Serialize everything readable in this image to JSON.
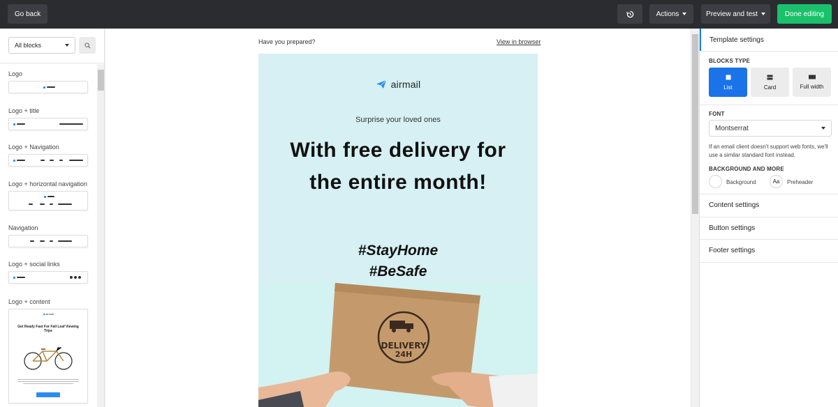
{
  "topbar": {
    "go_back": "Go back",
    "actions": "Actions",
    "preview": "Preview and test",
    "done": "Done editing"
  },
  "left_panel": {
    "filter_value": "All blocks",
    "blocks": [
      {
        "label": "Logo"
      },
      {
        "label": "Logo + title"
      },
      {
        "label": "Logo + Navigation"
      },
      {
        "label": "Logo + horizontal navigation"
      },
      {
        "label": "Navigation"
      },
      {
        "label": "Logo + social links"
      },
      {
        "label": "Logo + content"
      }
    ],
    "content_thumb": {
      "brand": "airmail",
      "heading": "Get Ready Fast For Fall Leaf Viewing Trips"
    }
  },
  "canvas": {
    "preheader": "Have you prepared?",
    "view_in_browser": "View in browser",
    "brand": "airmail",
    "subtitle": "Surprise your loved ones",
    "headline_1": "With free delivery for",
    "headline_2": "the entire month!",
    "tag_1": "#StayHome",
    "tag_2": "#BeSafe",
    "box_text_1": "DELIVERY",
    "box_text_2": "24H"
  },
  "right_panel": {
    "title": "Template settings",
    "blocks_type_label": "BLOCKS TYPE",
    "blocks_types": [
      {
        "label": "List",
        "active": true
      },
      {
        "label": "Card",
        "active": false
      },
      {
        "label": "Full width",
        "active": false
      }
    ],
    "font_label": "FONT",
    "font_value": "Montserrat",
    "font_note": "If an email client doesn't support web fonts, we'll use a similar standard font instead.",
    "background_label": "BACKGROUND AND MORE",
    "background": "Background",
    "preheader_swatch": "Aa",
    "preheader": "Preheader",
    "sections": [
      "Content settings",
      "Button settings",
      "Footer settings"
    ]
  },
  "colors": {
    "topbar": "#2b2c30",
    "accent": "#1a73e8",
    "done": "#19c16b",
    "email_bg": "#d6f0f3"
  }
}
